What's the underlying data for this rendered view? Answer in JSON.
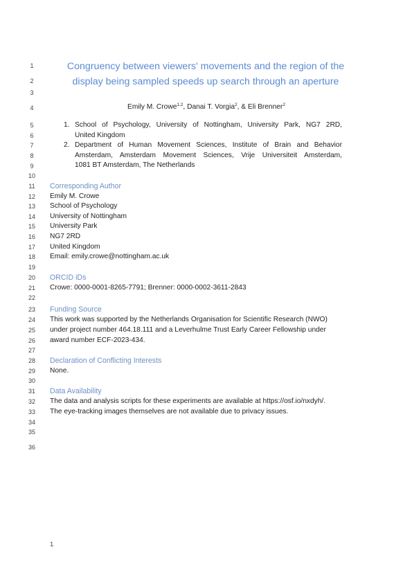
{
  "line_numbers": [
    "1",
    "2",
    "3",
    "4",
    "5",
    "6",
    "7",
    "8",
    "9",
    "10",
    "11",
    "12",
    "13",
    "14",
    "15",
    "16",
    "17",
    "18",
    "19",
    "20",
    "21",
    "22",
    "23",
    "24",
    "25",
    "26",
    "27",
    "28",
    "29",
    "30",
    "31",
    "32",
    "33",
    "34",
    "35",
    "36"
  ],
  "title": {
    "line1": "Congruency between viewers' movements and the region of the",
    "line2": "display being sampled speeds up search through an aperture",
    "color": "#5b8bd4"
  },
  "authors": [
    {
      "name": "Emily M. Crowe",
      "affil": "1,2",
      "sep": ", "
    },
    {
      "name": "Danai T. Vorgia",
      "affil": "2",
      "sep": ", & "
    },
    {
      "name": "Eli Brenner",
      "affil": "2",
      "sep": ""
    }
  ],
  "affiliations": [
    {
      "number": "1.",
      "lines": [
        "School of Psychology, University of Nottingham, University Park, NG7 2RD,",
        "United Kingdom"
      ]
    },
    {
      "number": "2.",
      "lines": [
        "Department of Human Movement Sciences, Institute of Brain and Behavior",
        "Amsterdam, Amsterdam Movement Sciences, Vrije Universiteit Amsterdam,",
        "1081 BT Amsterdam, The Netherlands"
      ]
    }
  ],
  "corresponding": {
    "heading": "Corresponding Author",
    "lines": [
      "Emily M. Crowe",
      "School of Psychology",
      "University of Nottingham",
      "University Park",
      "NG7 2RD",
      "United Kingdom",
      "Email: emily.crowe@nottingham.ac.uk"
    ]
  },
  "orcid": {
    "heading": "ORCID iDs",
    "text": "Crowe: 0000-0001-8265-7791; Brenner: 0000-0002-3611-2843"
  },
  "funding": {
    "heading": "Funding Source",
    "lines": [
      "This work was supported by the Netherlands Organisation for Scientific Research (NWO)",
      "under project number 464.18.111 and a Leverhulme Trust Early Career Fellowship under",
      "award number ECF-2023-434."
    ]
  },
  "conflicts": {
    "heading": "Declaration of Conflicting Interests",
    "text": "None."
  },
  "data_availability": {
    "heading": "Data Availability",
    "lines": [
      "The data and analysis scripts for these experiments are available at https://osf.io/nxdyh/.",
      "The eye-tracking images themselves are not available due to privacy issues."
    ]
  },
  "page_number": "1",
  "heading_color": "#6d8fc9"
}
